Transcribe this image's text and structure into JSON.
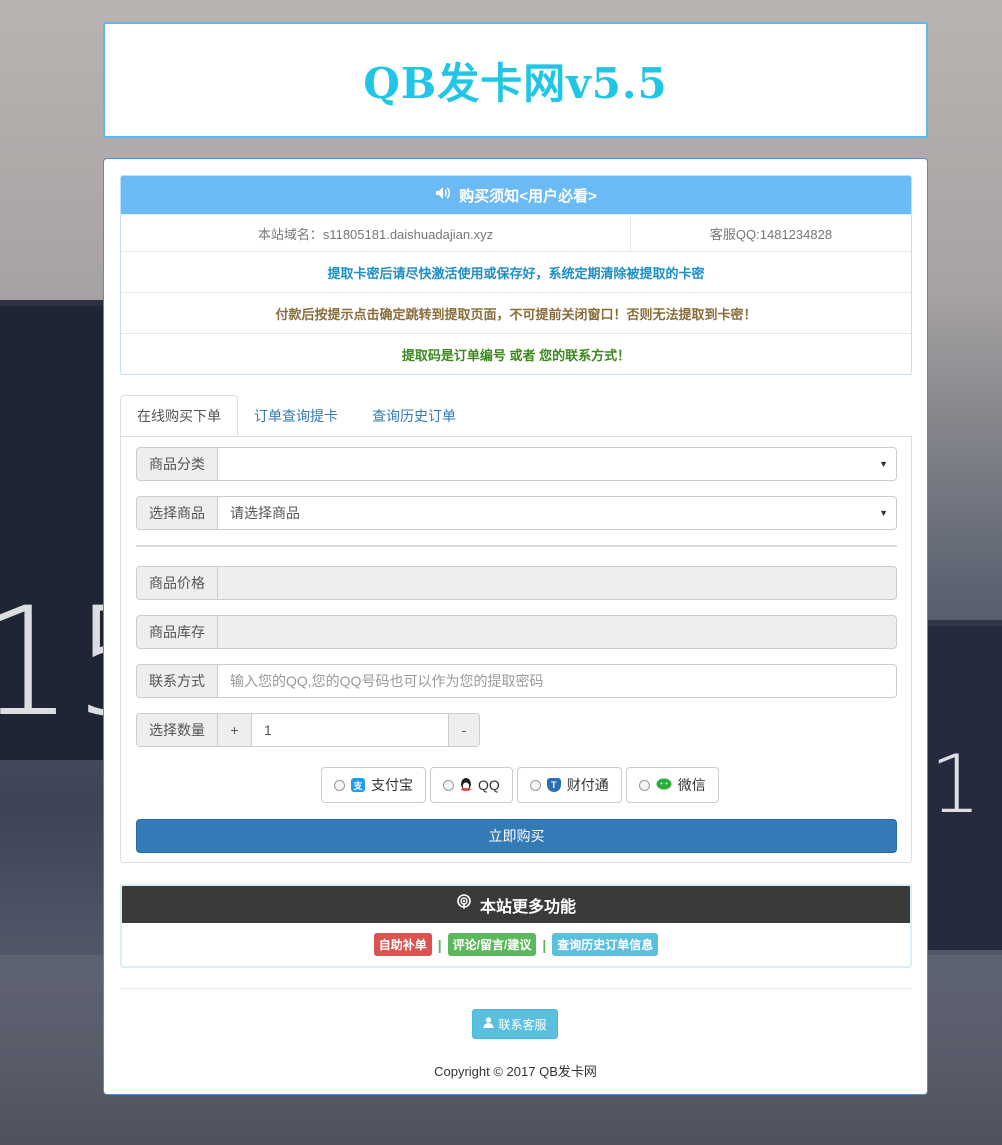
{
  "header": {
    "title": "QB发卡网v5.5"
  },
  "notice": {
    "title": "购买须知<用户必看>",
    "domain": "本站域名：s11805181.daishuadajian.xyz",
    "service_qq": "客服QQ:1481234828",
    "line1": "提取卡密后请尽快激活使用或保存好，系统定期清除被提取的卡密",
    "line2": "付款后按提示点击确定跳转到提取页面，不可提前关闭窗口！否则无法提取到卡密！",
    "line3": "提取码是订单编号 或者 您的联系方式！",
    "colors": {
      "line1": "#1e8fc6",
      "line2": "#8a6d3b",
      "line3": "#3c8a1e"
    }
  },
  "tabs": [
    "在线购买下单",
    "订单查询提卡",
    "查询历史订单"
  ],
  "form": {
    "category_label": "商品分类",
    "category_value": "",
    "product_label": "选择商品",
    "product_value": "请选择商品",
    "price_label": "商品价格",
    "stock_label": "商品库存",
    "contact_label": "联系方式",
    "contact_placeholder": "输入您的QQ,您的QQ号码也可以作为您的提取密码",
    "quantity_label": "选择数量",
    "plus": "+",
    "minus": "-",
    "quantity": "1",
    "payments": [
      "支付宝",
      "QQ",
      "财付通",
      "微信"
    ],
    "buy_label": "立即购买"
  },
  "more": {
    "title": "本站更多功能",
    "links": [
      "自助补单",
      "评论/留言/建议",
      "查询历史订单信息"
    ],
    "separator": "|"
  },
  "footer": {
    "contact_label": "联系客服",
    "copyright": "Copyright © 2017 QB发卡网"
  },
  "background": {
    "clock_left": "15",
    "clock_right": "1"
  }
}
